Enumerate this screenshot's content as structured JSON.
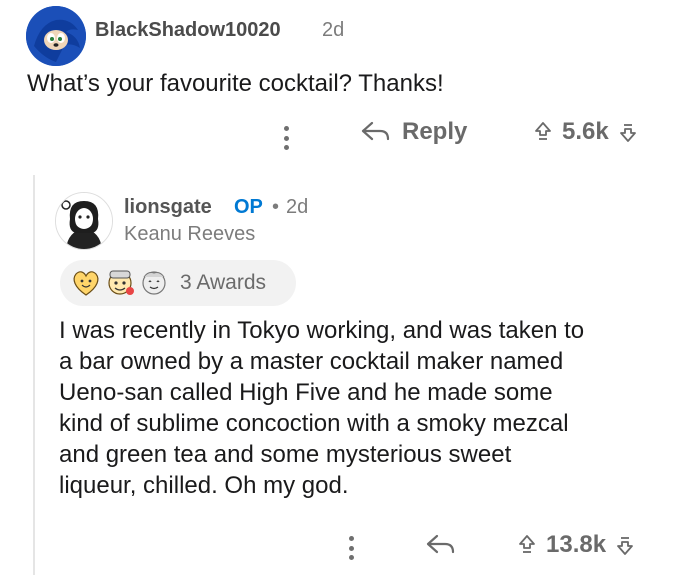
{
  "comment": {
    "username": "BlackShadow10020",
    "age": "2d",
    "body": "What’s your favourite cocktail? Thanks!",
    "reply_label": "Reply",
    "score": "5.6k"
  },
  "reply": {
    "username": "lionsgate",
    "op_badge": "OP",
    "age_prefix": "•",
    "age": "2d",
    "flair": "Keanu Reeves",
    "awards_label": "3 Awards",
    "body_lines": [
      "I was recently in Tokyo working, and was taken to",
      "a bar owned by a master cocktail maker named",
      "Ueno-san called High Five and he made some",
      "kind of sublime concoction with a smoky mezcal",
      "and green tea and some mysterious sweet",
      "liqueur, chilled. Oh my god."
    ],
    "score": "13.8k"
  },
  "colors": {
    "op_blue": "#0079d3",
    "meta_gray": "#7c7c7c",
    "text": "#1a1a1b"
  }
}
